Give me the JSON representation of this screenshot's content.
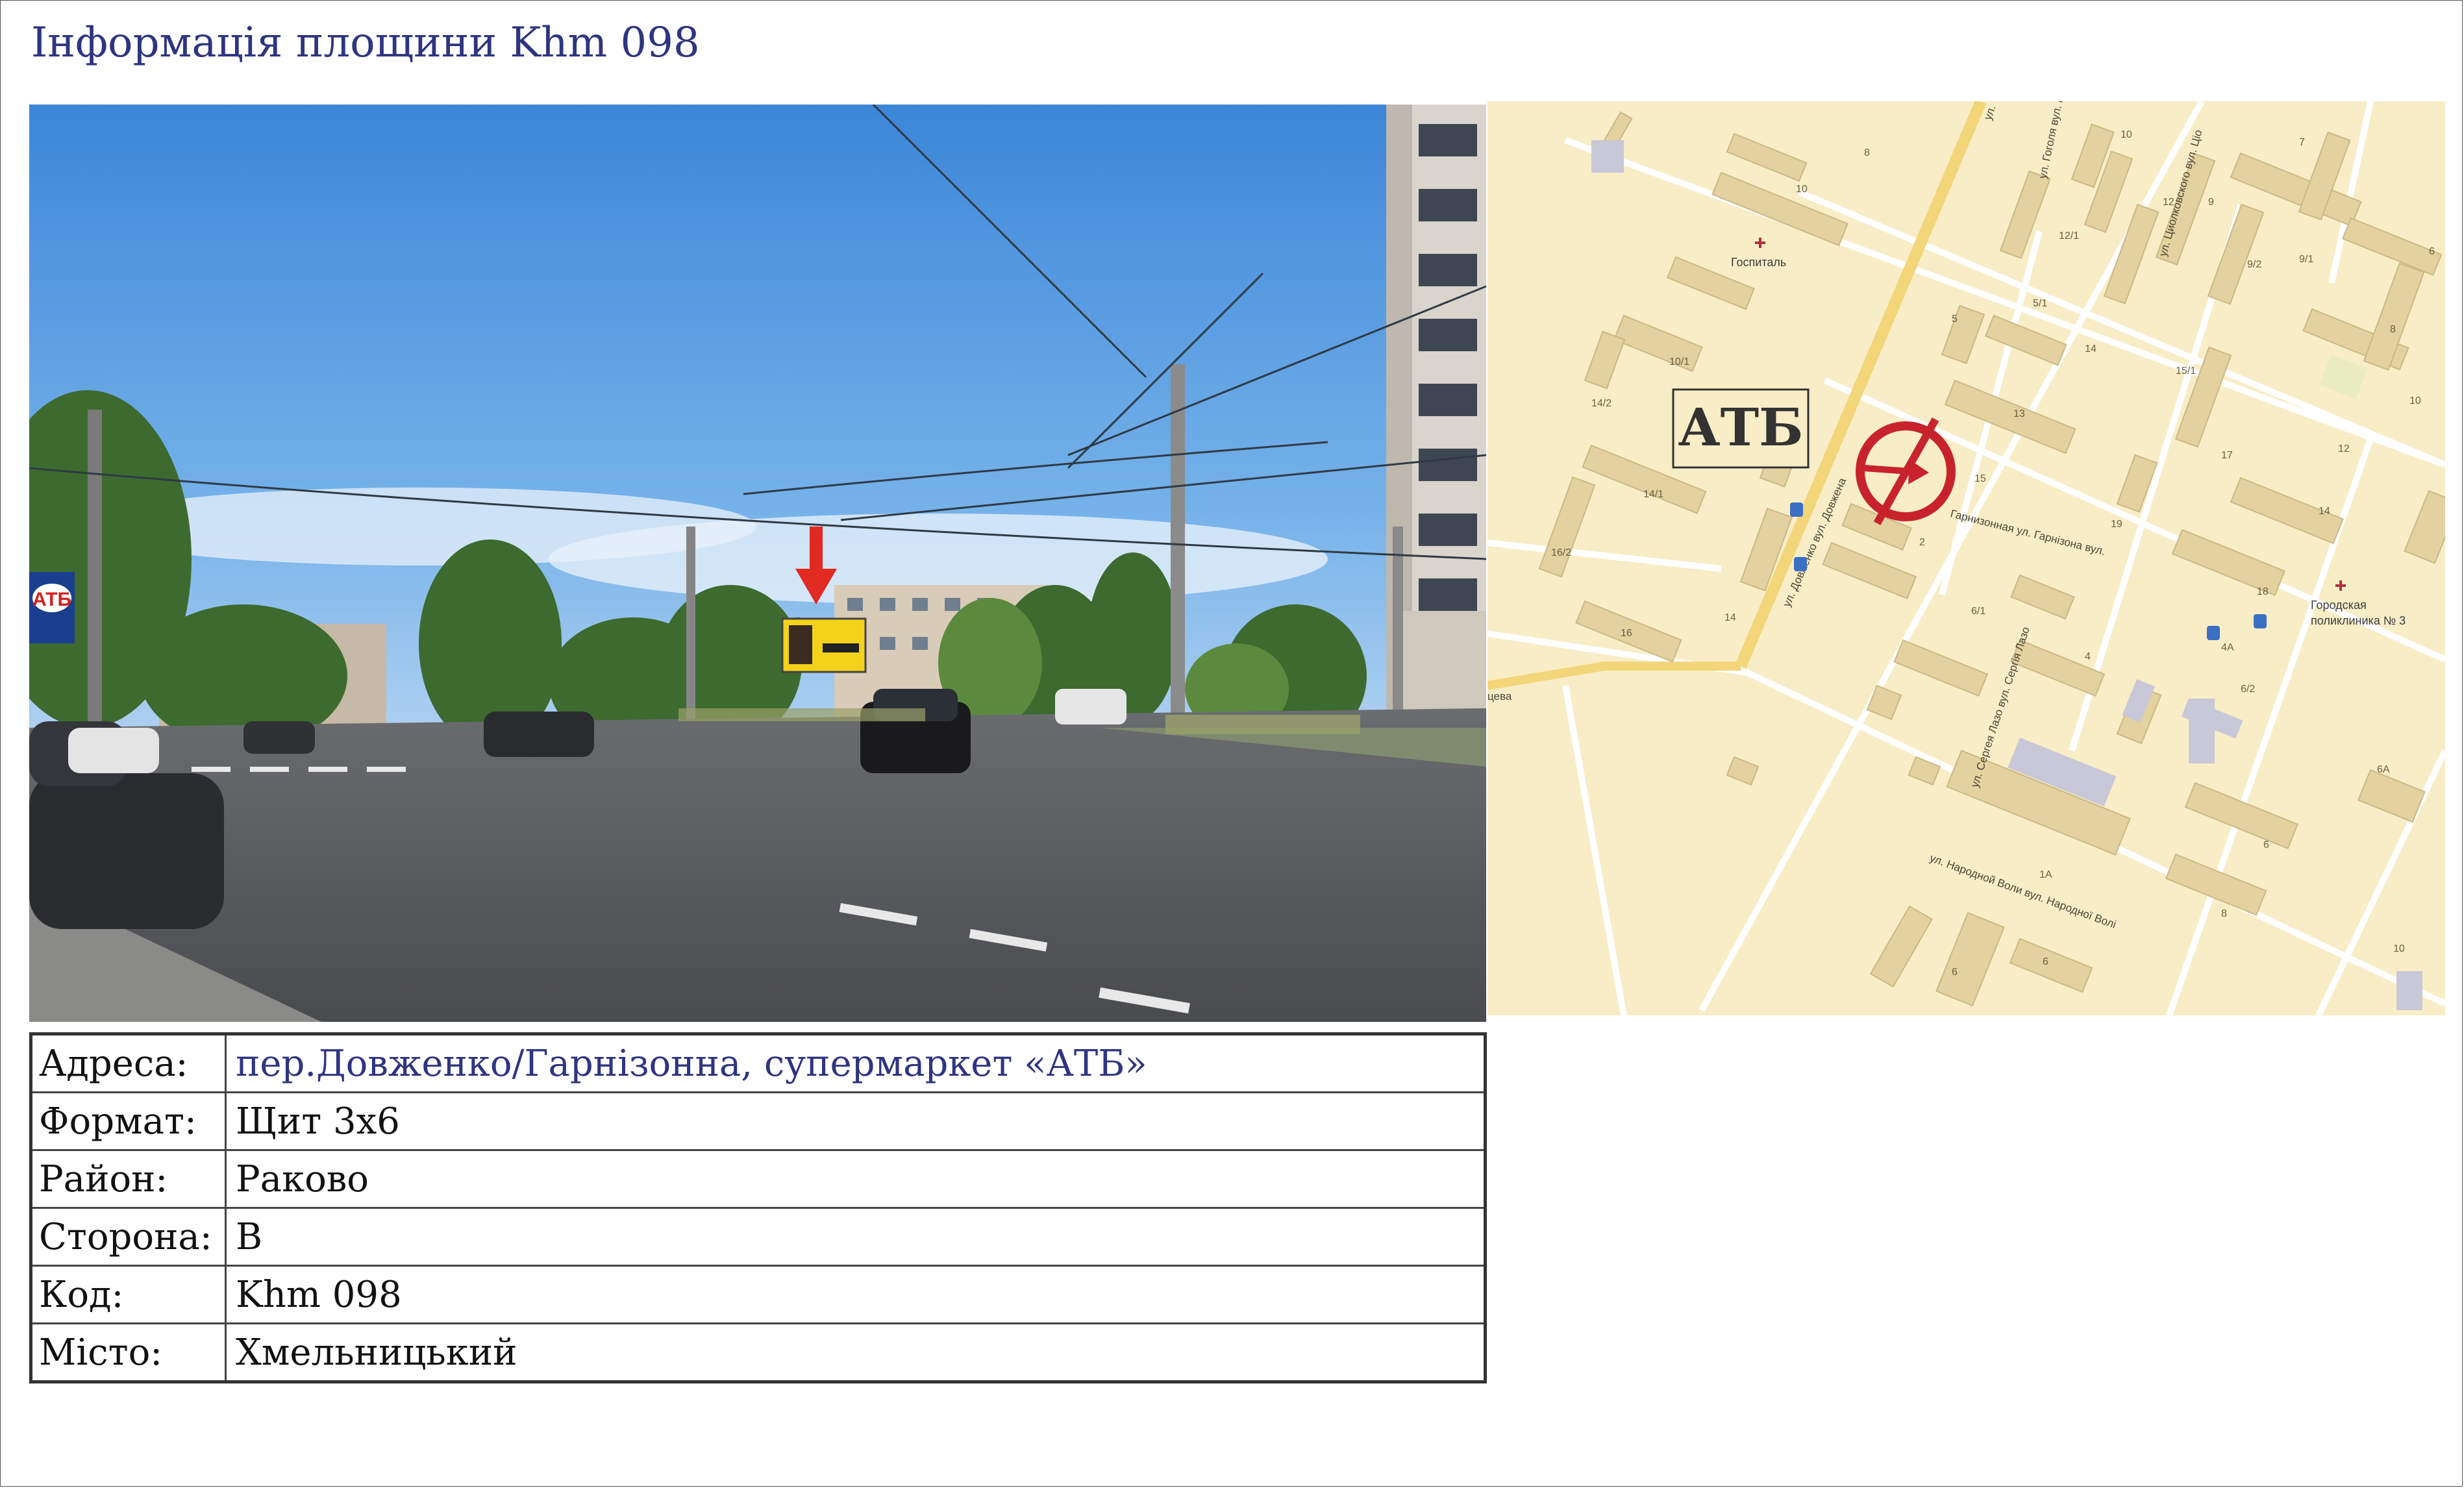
{
  "title": "Інформація площини Khm 098",
  "info_rows": [
    {
      "label": "Адреса:",
      "value": "пер.Довженко/Гарнізонна, супермаркет «АТБ»"
    },
    {
      "label": "Формат:",
      "value": "Щит 3х6"
    },
    {
      "label": "Район:",
      "value": "Раково"
    },
    {
      "label": "Сторона:",
      "value": "B"
    },
    {
      "label": "Код:",
      "value": "Khm 098"
    },
    {
      "label": "Місто:",
      "value": "Хмельницький"
    }
  ],
  "photo": {
    "store_sign": "АТБ"
  },
  "map": {
    "store_label": "АТБ",
    "labels": {
      "gospital": "Госпиталь",
      "poliklinika_1": "Городская",
      "poliklinika_2": "поликлиника № 3",
      "street_dovzhenka": "ул. Довженко вул. Довжена",
      "street_garnizonna": "Гарнизонная ул. Гарнізона вул.",
      "street_lazo": "ул. Сергея Лазо вул. Сергія Лазо",
      "street_narodnoi_voli": "ул. Народной Воли вул. Народної Волі",
      "street_ciolkovskogo": "ул. Циолковского вул. Ціо",
      "street_top": "ул.",
      "street_gogolya": "ул. Гоголя вул. г",
      "street_left": "цева"
    },
    "house_numbers": [
      "8",
      "10",
      "7",
      "10",
      "12",
      "9",
      "12/1",
      "5/1",
      "9/2",
      "9/1",
      "6",
      "5",
      "14",
      "15/1",
      "8",
      "10/1",
      "14/2",
      "13",
      "10",
      "17",
      "12",
      "15",
      "19",
      "14/1",
      "14",
      "16/2",
      "2",
      "18",
      "6/1",
      "4",
      "16",
      "14",
      "4А",
      "6/2",
      "6А",
      "1А",
      "6",
      "8",
      "6",
      "6",
      "10"
    ],
    "colors": {
      "background": "#f8edc6",
      "building": "#e3d1a0",
      "road": "#ffffff",
      "main_road": "#f3d57a",
      "marker": "#c8232c"
    }
  }
}
